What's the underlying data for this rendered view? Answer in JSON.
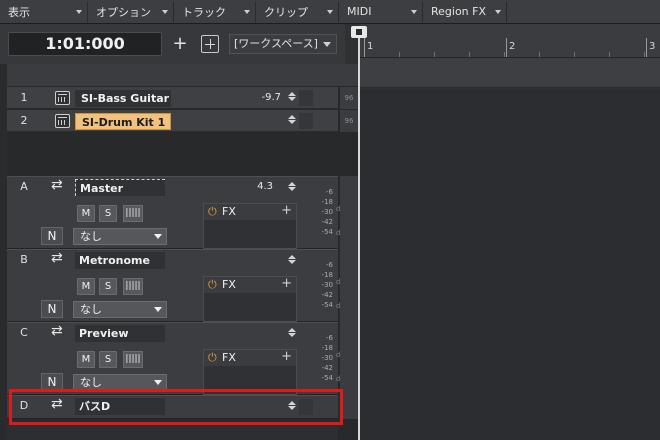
{
  "menubar": {
    "items": [
      {
        "label": "表示",
        "width": 88
      },
      {
        "label": "オプション",
        "width": 86
      },
      {
        "label": "トラック",
        "width": 82
      },
      {
        "label": "クリップ",
        "width": 83
      },
      {
        "label": "MIDI",
        "width": 84
      },
      {
        "label": "Region FX",
        "width": 84
      }
    ]
  },
  "transport": {
    "time": "1:01:000",
    "plus": "+",
    "workspace": "[ワークスペース]"
  },
  "ruler": {
    "bars": [
      {
        "num": "1"
      },
      {
        "num": "2"
      },
      {
        "num": "3"
      }
    ]
  },
  "tracks": [
    {
      "num": "1",
      "name": "SI-Bass Guitar",
      "volume": "-9.7",
      "selected": false,
      "scale": "96"
    },
    {
      "num": "2",
      "name": "SI-Drum Kit 1",
      "volume": "",
      "selected": true,
      "scale": "96"
    }
  ],
  "buses": [
    {
      "letter": "A",
      "name": "Master",
      "volume": "4.3",
      "m": "M",
      "s": "S",
      "wave": "|||||",
      "auto": "N",
      "output": "なし",
      "fx": "FX",
      "db": [
        "-6",
        "-18",
        "-30",
        "-42",
        "-54"
      ],
      "db_label": "dB"
    },
    {
      "letter": "B",
      "name": "Metronome",
      "volume": "",
      "m": "M",
      "s": "S",
      "wave": "|||||",
      "auto": "N",
      "output": "なし",
      "fx": "FX",
      "db": [
        "-6",
        "-18",
        "-30",
        "-42",
        "-54"
      ],
      "db_label": "dB"
    },
    {
      "letter": "C",
      "name": "Preview",
      "volume": "",
      "m": "M",
      "s": "S",
      "wave": "|||||",
      "auto": "N",
      "output": "なし",
      "fx": "FX",
      "db": [
        "-6",
        "-18",
        "-30",
        "-42",
        "-54"
      ],
      "db_label": "dB"
    },
    {
      "letter": "D",
      "name": "バスD",
      "volume": "",
      "collapsed": true
    }
  ]
}
